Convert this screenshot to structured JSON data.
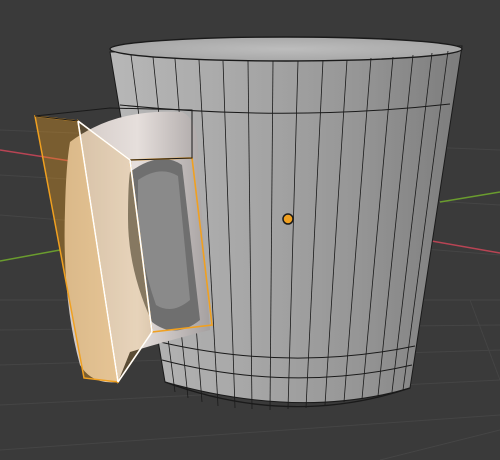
{
  "viewport": {
    "background": "#3a3a3a",
    "grid_color": "#454545",
    "axis_x_color": "#b84454",
    "axis_y_color": "#6a9c2e"
  },
  "mesh": {
    "object": "mug",
    "body_color": "#9a9a9a",
    "wire_color": "#1a1a1a",
    "selection_color": "#f0a020",
    "active_edge_color": "#ffffff",
    "origin_color": "#f0a020"
  }
}
